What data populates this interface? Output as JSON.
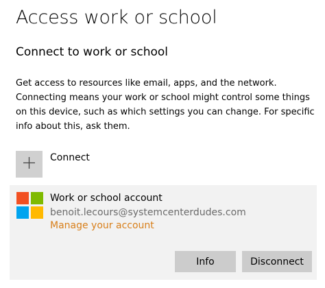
{
  "header": {
    "title": "Access work or school"
  },
  "section": {
    "title": "Connect to work or school",
    "description": "Get access to resources like email, apps, and the network. Connecting means your work or school might control some things on this device, such as which settings you can change. For specific info about this, ask them."
  },
  "connect": {
    "label": "Connect",
    "icon": "plus-icon"
  },
  "account": {
    "name": "Work or school account",
    "email": "benoit.lecours@systemcenterdudes.com",
    "manage_link": "Manage your account",
    "icon": "microsoft-logo-icon",
    "info_button": "Info",
    "disconnect_button": "Disconnect"
  },
  "colors": {
    "link": "#d87f1a",
    "panel_background": "#f2f2f2",
    "button_background": "#cccccc",
    "logo_red": "#f25022",
    "logo_green": "#7fba00",
    "logo_blue": "#00a4ef",
    "logo_yellow": "#ffb900"
  }
}
